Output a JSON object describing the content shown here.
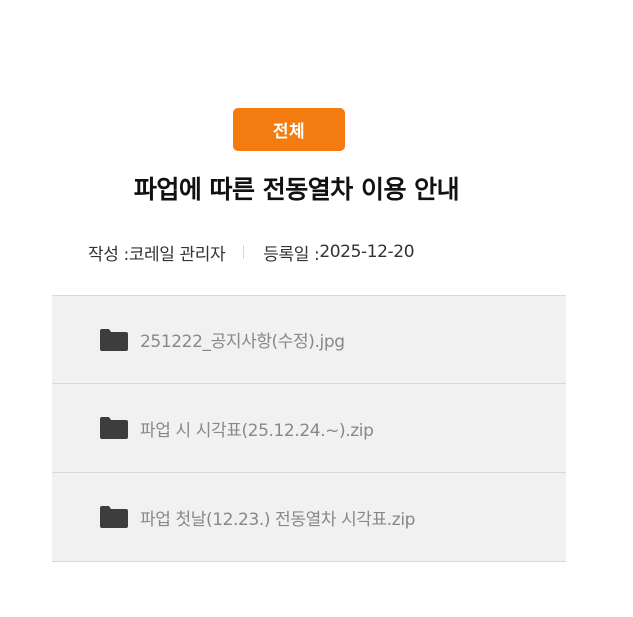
{
  "post": {
    "category": "전체",
    "title": "파업에 따른 전동열차 이용 안내",
    "author_label": "작성 : ",
    "author": "코레일 관리자",
    "date_label": "등록일 : ",
    "date": "2025-12-20"
  },
  "attachments": [
    {
      "name": "251222_공지사항(수정).jpg",
      "icon": "folder-icon"
    },
    {
      "name": "파업 시 시각표(25.12.24.~).zip",
      "icon": "folder-icon"
    },
    {
      "name": "파업 첫날(12.23.) 전동열차 시각표.zip",
      "icon": "folder-icon"
    }
  ],
  "colors": {
    "badge_bg": "#f47b10",
    "attachment_bg": "#f1f1f1",
    "file_text": "#888888",
    "icon": "#3d3d3d"
  }
}
